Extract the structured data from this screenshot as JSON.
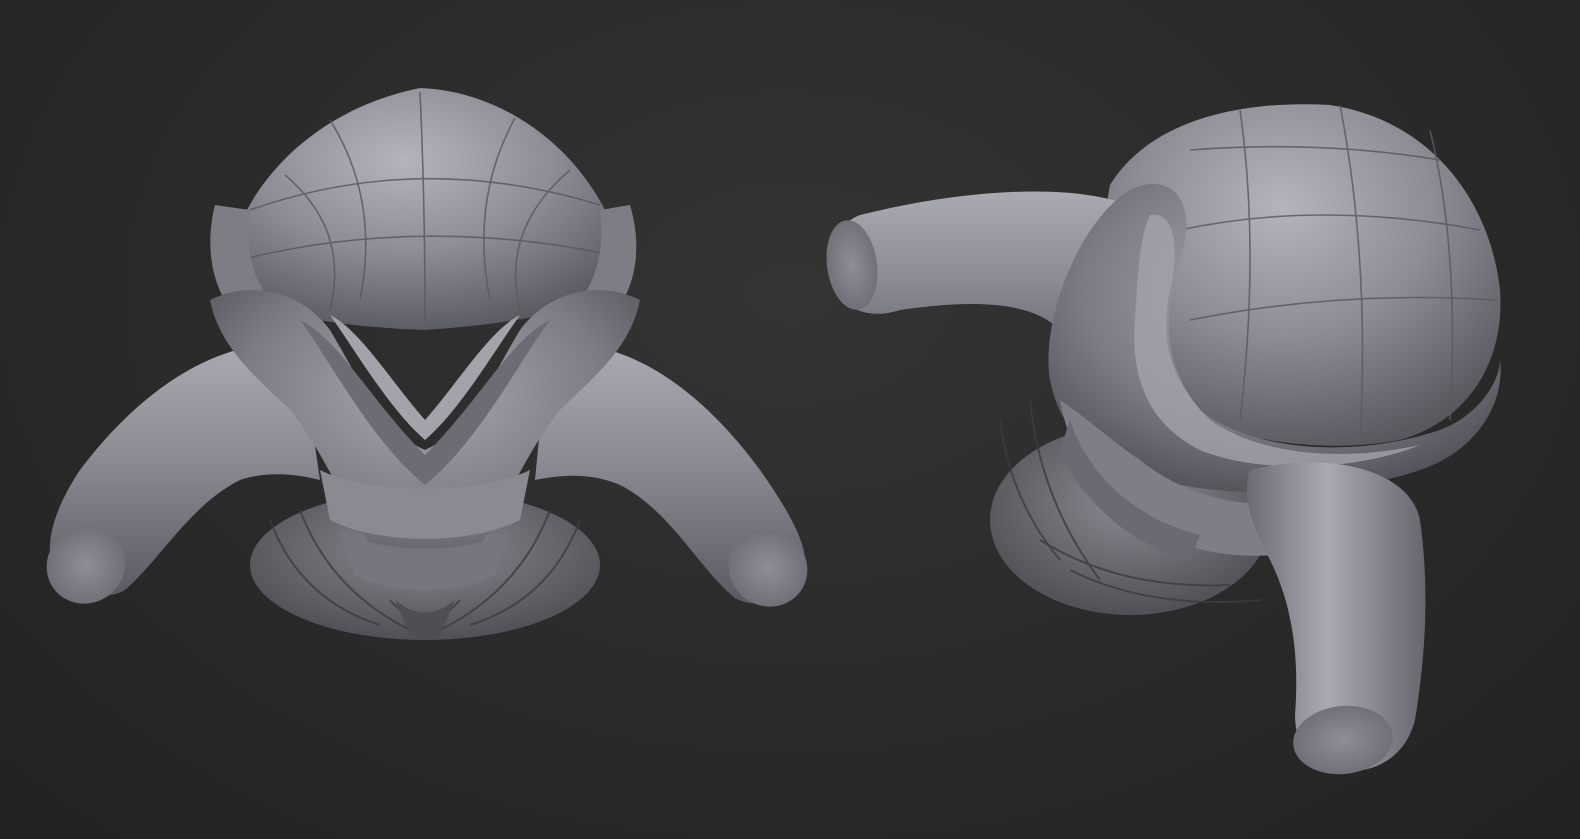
{
  "scene": {
    "models": [
      {
        "view": "front"
      },
      {
        "view": "three-quarter"
      }
    ]
  }
}
